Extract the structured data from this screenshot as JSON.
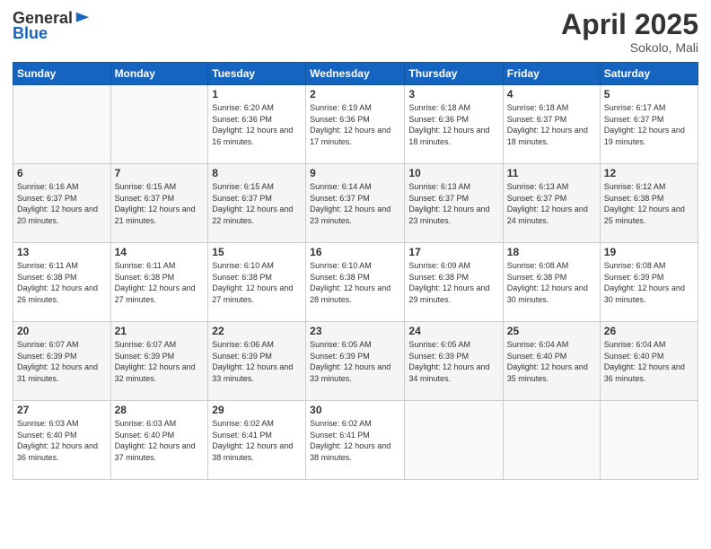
{
  "logo": {
    "general": "General",
    "blue": "Blue"
  },
  "title": "April 2025",
  "location": "Sokolo, Mali",
  "days_header": [
    "Sunday",
    "Monday",
    "Tuesday",
    "Wednesday",
    "Thursday",
    "Friday",
    "Saturday"
  ],
  "weeks": [
    [
      {
        "day": "",
        "info": ""
      },
      {
        "day": "",
        "info": ""
      },
      {
        "day": "1",
        "info": "Sunrise: 6:20 AM\nSunset: 6:36 PM\nDaylight: 12 hours and 16 minutes."
      },
      {
        "day": "2",
        "info": "Sunrise: 6:19 AM\nSunset: 6:36 PM\nDaylight: 12 hours and 17 minutes."
      },
      {
        "day": "3",
        "info": "Sunrise: 6:18 AM\nSunset: 6:36 PM\nDaylight: 12 hours and 18 minutes."
      },
      {
        "day": "4",
        "info": "Sunrise: 6:18 AM\nSunset: 6:37 PM\nDaylight: 12 hours and 18 minutes."
      },
      {
        "day": "5",
        "info": "Sunrise: 6:17 AM\nSunset: 6:37 PM\nDaylight: 12 hours and 19 minutes."
      }
    ],
    [
      {
        "day": "6",
        "info": "Sunrise: 6:16 AM\nSunset: 6:37 PM\nDaylight: 12 hours and 20 minutes."
      },
      {
        "day": "7",
        "info": "Sunrise: 6:15 AM\nSunset: 6:37 PM\nDaylight: 12 hours and 21 minutes."
      },
      {
        "day": "8",
        "info": "Sunrise: 6:15 AM\nSunset: 6:37 PM\nDaylight: 12 hours and 22 minutes."
      },
      {
        "day": "9",
        "info": "Sunrise: 6:14 AM\nSunset: 6:37 PM\nDaylight: 12 hours and 23 minutes."
      },
      {
        "day": "10",
        "info": "Sunrise: 6:13 AM\nSunset: 6:37 PM\nDaylight: 12 hours and 23 minutes."
      },
      {
        "day": "11",
        "info": "Sunrise: 6:13 AM\nSunset: 6:37 PM\nDaylight: 12 hours and 24 minutes."
      },
      {
        "day": "12",
        "info": "Sunrise: 6:12 AM\nSunset: 6:38 PM\nDaylight: 12 hours and 25 minutes."
      }
    ],
    [
      {
        "day": "13",
        "info": "Sunrise: 6:11 AM\nSunset: 6:38 PM\nDaylight: 12 hours and 26 minutes."
      },
      {
        "day": "14",
        "info": "Sunrise: 6:11 AM\nSunset: 6:38 PM\nDaylight: 12 hours and 27 minutes."
      },
      {
        "day": "15",
        "info": "Sunrise: 6:10 AM\nSunset: 6:38 PM\nDaylight: 12 hours and 27 minutes."
      },
      {
        "day": "16",
        "info": "Sunrise: 6:10 AM\nSunset: 6:38 PM\nDaylight: 12 hours and 28 minutes."
      },
      {
        "day": "17",
        "info": "Sunrise: 6:09 AM\nSunset: 6:38 PM\nDaylight: 12 hours and 29 minutes."
      },
      {
        "day": "18",
        "info": "Sunrise: 6:08 AM\nSunset: 6:38 PM\nDaylight: 12 hours and 30 minutes."
      },
      {
        "day": "19",
        "info": "Sunrise: 6:08 AM\nSunset: 6:39 PM\nDaylight: 12 hours and 30 minutes."
      }
    ],
    [
      {
        "day": "20",
        "info": "Sunrise: 6:07 AM\nSunset: 6:39 PM\nDaylight: 12 hours and 31 minutes."
      },
      {
        "day": "21",
        "info": "Sunrise: 6:07 AM\nSunset: 6:39 PM\nDaylight: 12 hours and 32 minutes."
      },
      {
        "day": "22",
        "info": "Sunrise: 6:06 AM\nSunset: 6:39 PM\nDaylight: 12 hours and 33 minutes."
      },
      {
        "day": "23",
        "info": "Sunrise: 6:05 AM\nSunset: 6:39 PM\nDaylight: 12 hours and 33 minutes."
      },
      {
        "day": "24",
        "info": "Sunrise: 6:05 AM\nSunset: 6:39 PM\nDaylight: 12 hours and 34 minutes."
      },
      {
        "day": "25",
        "info": "Sunrise: 6:04 AM\nSunset: 6:40 PM\nDaylight: 12 hours and 35 minutes."
      },
      {
        "day": "26",
        "info": "Sunrise: 6:04 AM\nSunset: 6:40 PM\nDaylight: 12 hours and 36 minutes."
      }
    ],
    [
      {
        "day": "27",
        "info": "Sunrise: 6:03 AM\nSunset: 6:40 PM\nDaylight: 12 hours and 36 minutes."
      },
      {
        "day": "28",
        "info": "Sunrise: 6:03 AM\nSunset: 6:40 PM\nDaylight: 12 hours and 37 minutes."
      },
      {
        "day": "29",
        "info": "Sunrise: 6:02 AM\nSunset: 6:41 PM\nDaylight: 12 hours and 38 minutes."
      },
      {
        "day": "30",
        "info": "Sunrise: 6:02 AM\nSunset: 6:41 PM\nDaylight: 12 hours and 38 minutes."
      },
      {
        "day": "",
        "info": ""
      },
      {
        "day": "",
        "info": ""
      },
      {
        "day": "",
        "info": ""
      }
    ]
  ]
}
